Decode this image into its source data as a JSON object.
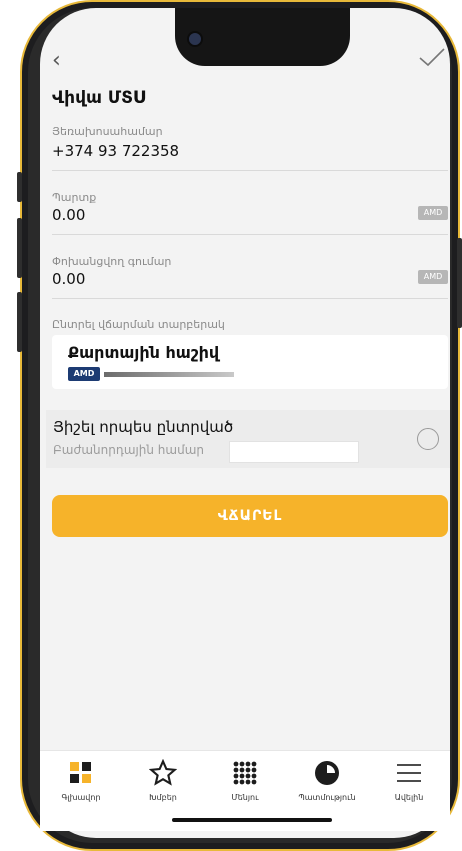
{
  "screen": {
    "title": "Վիվա ՄՏՍ",
    "back_icon": "chevron-left-icon",
    "confirm_icon": "checkmark-icon"
  },
  "fields": {
    "subscriber": {
      "label": "Յեռախոսահամար",
      "value": "+374 93 722358"
    },
    "debt": {
      "label": "Պարտք",
      "value": "0.00",
      "currency": "AMD"
    },
    "transfer_amount": {
      "label": "Փոխանցվող գումար",
      "value": "0.00",
      "currency": "AMD"
    }
  },
  "payment_method": {
    "label": "Ընտրել վճարման տարբերակ",
    "card_title": "Քարտային հաշիվ",
    "card_currency": "AMD"
  },
  "save_option": {
    "title": "Յիշել որպես ընտրված",
    "subscriber_label": "Բաժանորդային համար",
    "selected": false
  },
  "pay_button": {
    "label": "ՎՃԱՐԵԼ",
    "color": "#f6b32a"
  },
  "tabbar": {
    "items": [
      {
        "label": "Գլխավոր",
        "icon": "grid-icon"
      },
      {
        "label": "Խմբեր",
        "icon": "star-icon"
      },
      {
        "label": "Մենյու",
        "icon": "dots-grid-icon"
      },
      {
        "label": "Պատմություն",
        "icon": "history-pie-icon"
      },
      {
        "label": "Ավելին",
        "icon": "menu-lines-icon"
      }
    ]
  },
  "colors": {
    "accent": "#f6b32a",
    "badge": "#1d3b73",
    "frame": "#e8b93a"
  }
}
